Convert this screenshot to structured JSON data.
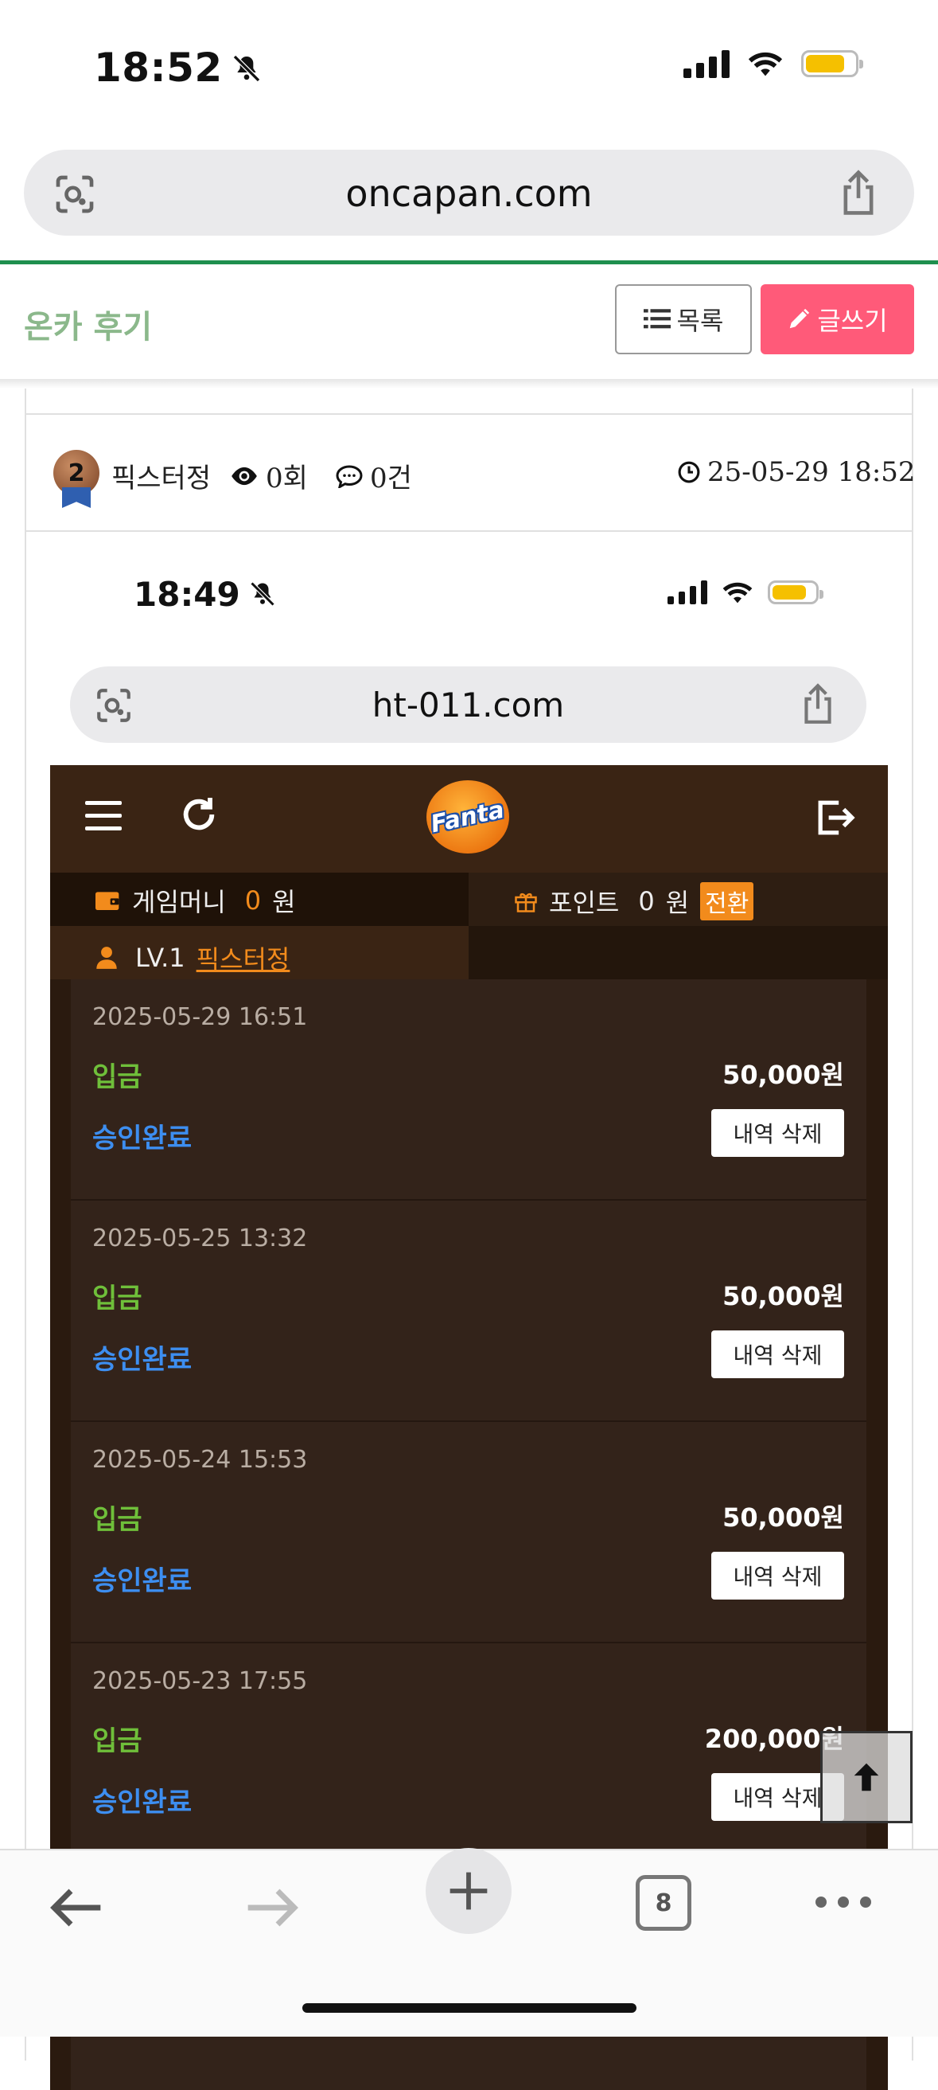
{
  "status_bar": {
    "time": "18:52"
  },
  "browser": {
    "url": "oncapan.com",
    "tab_count": "8"
  },
  "board": {
    "title": "온카 후기",
    "list_label": "목록",
    "write_label": "글쓰기"
  },
  "post": {
    "author": "픽스터정",
    "author_level": "2",
    "views": "0회",
    "comments": "0건",
    "datetime": "25-05-29 18:52"
  },
  "inner_screenshot": {
    "status_time": "18:49",
    "url": "ht-011.com",
    "logo_text": "Fanta",
    "game_money_label": "게임머니",
    "game_money_value": "0",
    "game_money_unit": "원",
    "point_label": "포인트",
    "point_value": "0",
    "point_unit": "원",
    "convert_label": "전환",
    "level": "LV.1",
    "nickname": "픽스터정",
    "transactions": [
      {
        "date": "2025-05-29 16:51",
        "type": "입금",
        "amount": "50,000원",
        "status": "승인완료",
        "delete_label": "내역 삭제"
      },
      {
        "date": "2025-05-25 13:32",
        "type": "입금",
        "amount": "50,000원",
        "status": "승인완료",
        "delete_label": "내역 삭제"
      },
      {
        "date": "2025-05-24 15:53",
        "type": "입금",
        "amount": "50,000원",
        "status": "승인완료",
        "delete_label": "내역 삭제"
      },
      {
        "date": "2025-05-23 17:55",
        "type": "입금",
        "amount": "200,000원",
        "status": "승인완료",
        "delete_label": "내역 삭제"
      }
    ]
  },
  "colors": {
    "accent_green": "#1f8f4e",
    "write_button": "#ff5a79",
    "app_bg": "#2a1a0f",
    "orange": "#f28b1c"
  }
}
